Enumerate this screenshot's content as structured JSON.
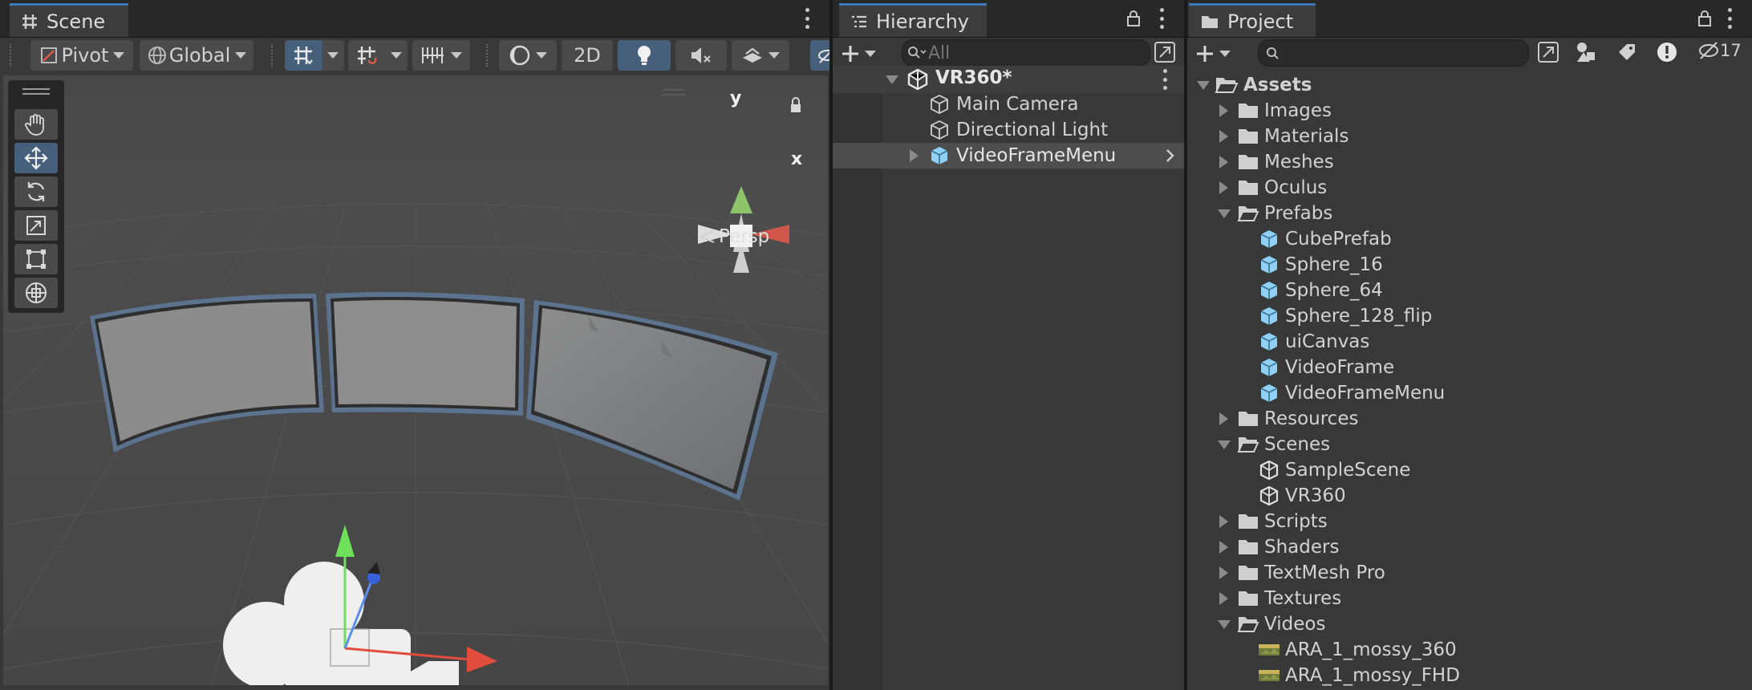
{
  "scene": {
    "tab_label": "Scene",
    "pivot_label": "Pivot",
    "global_label": "Global",
    "mode_2d_label": "2D",
    "persp_label": "Persp",
    "gizmo_y_label": "y",
    "gizmo_x_label": "x"
  },
  "hierarchy": {
    "tab_label": "Hierarchy",
    "search_placeholder": "All",
    "root_label": "VR360*",
    "items": [
      {
        "label": "Main Camera"
      },
      {
        "label": "Directional Light"
      },
      {
        "label": "VideoFrameMenu"
      }
    ]
  },
  "project": {
    "tab_label": "Project",
    "hidden_count": "17",
    "root_label": "Assets",
    "items": [
      {
        "label": "Images"
      },
      {
        "label": "Materials"
      },
      {
        "label": "Meshes"
      },
      {
        "label": "Oculus"
      },
      {
        "label": "Prefabs"
      },
      {
        "label": "CubePrefab"
      },
      {
        "label": "Sphere_16"
      },
      {
        "label": "Sphere_64"
      },
      {
        "label": "Sphere_128_flip"
      },
      {
        "label": "uiCanvas"
      },
      {
        "label": "VideoFrame"
      },
      {
        "label": "VideoFrameMenu"
      },
      {
        "label": "Resources"
      },
      {
        "label": "Scenes"
      },
      {
        "label": "SampleScene"
      },
      {
        "label": "VR360"
      },
      {
        "label": "Scripts"
      },
      {
        "label": "Shaders"
      },
      {
        "label": "TextMesh Pro"
      },
      {
        "label": "Textures"
      },
      {
        "label": "Videos"
      },
      {
        "label": "ARA_1_mossy_360"
      },
      {
        "label": "ARA_1_mossy_FHD"
      }
    ]
  },
  "colors": {
    "selection": "#46607c",
    "accent": "#3a79bb",
    "prefab": "#8fd0f5",
    "panel_bg": "#383838"
  }
}
